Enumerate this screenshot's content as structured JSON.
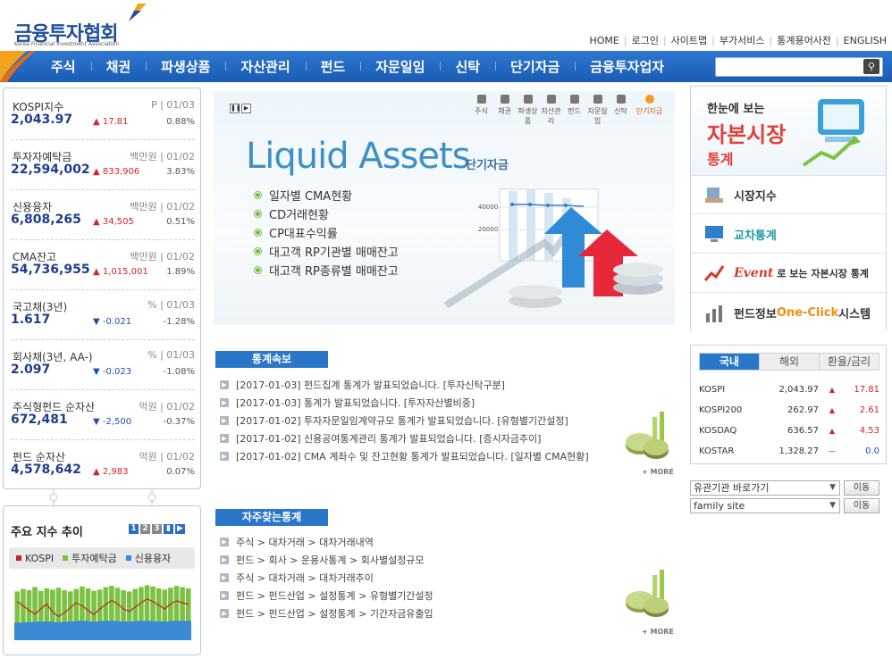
{
  "header": {
    "logo_title": "금융투자협회",
    "logo_subtitle": "Korea Financial Investment Association",
    "top_links": [
      "HOME",
      "로그인",
      "사이트맵",
      "부가서비스",
      "통계용어사전",
      "ENGLISH"
    ],
    "main_nav": [
      "주식",
      "채권",
      "파생상품",
      "자산관리",
      "펀드",
      "자문일임",
      "신탁",
      "단기자금",
      "금융투자업자"
    ],
    "search_placeholder": ""
  },
  "indices": [
    {
      "name": "KOSPI지수",
      "meta": "P | 01/03",
      "value": "2,043.97",
      "dir": "up",
      "change": "17.81",
      "pct": "0.88%"
    },
    {
      "name": "투자자예탁금",
      "meta": "백만원 | 01/02",
      "value": "22,594,002",
      "dir": "up",
      "change": "833,906",
      "pct": "3.83%"
    },
    {
      "name": "신용융자",
      "meta": "백만원 | 01/02",
      "value": "6,808,265",
      "dir": "up",
      "change": "34,505",
      "pct": "0.51%"
    },
    {
      "name": "CMA잔고",
      "meta": "백만원 | 01/02",
      "value": "54,736,955",
      "dir": "up",
      "change": "1,015,001",
      "pct": "1.89%"
    },
    {
      "name": "국고채(3년)",
      "meta": "% | 01/03",
      "value": "1.617",
      "dir": "dn",
      "change": "-0.021",
      "pct": "-1.28%"
    },
    {
      "name": "회사채(3년, AA-)",
      "meta": "% | 01/03",
      "value": "2.097",
      "dir": "dn",
      "change": "-0.023",
      "pct": "-1.08%"
    },
    {
      "name": "주식형펀드 순자산",
      "meta": "억원 | 01/02",
      "value": "672,481",
      "dir": "dn",
      "change": "-2,500",
      "pct": "-0.37%"
    },
    {
      "name": "펀드 순자산",
      "meta": "억원 | 01/02",
      "value": "4,578,642",
      "dir": "up",
      "change": "2,983",
      "pct": "0.07%"
    }
  ],
  "trend": {
    "title": "주요 지수 추이",
    "pages": [
      "1",
      "2",
      "3"
    ],
    "legend": [
      {
        "label": "KOSPI",
        "color": "#c8202a"
      },
      {
        "label": "투자예탁금",
        "color": "#7cc242"
      },
      {
        "label": "신용융자",
        "color": "#3a8ad6"
      }
    ]
  },
  "chart_data": {
    "type": "area",
    "title": "",
    "xlabel": "",
    "ylabel": "",
    "series": [
      {
        "name": "KOSPI",
        "values": [
          0.62,
          0.55,
          0.48,
          0.42,
          0.5,
          0.58,
          0.45,
          0.38,
          0.44,
          0.52,
          0.6,
          0.55,
          0.48,
          0.41,
          0.5,
          0.57,
          0.64,
          0.58,
          0.5,
          0.46,
          0.53,
          0.6,
          0.66,
          0.62,
          0.56,
          0.5,
          0.58,
          0.63,
          0.6,
          0.57
        ]
      },
      {
        "name": "투자예탁금",
        "values": [
          0.78,
          0.82,
          0.8,
          0.85,
          0.79,
          0.83,
          0.81,
          0.84,
          0.8,
          0.78,
          0.82,
          0.86,
          0.83,
          0.79,
          0.81,
          0.85,
          0.87,
          0.84,
          0.8,
          0.78,
          0.82,
          0.85,
          0.88,
          0.86,
          0.83,
          0.81,
          0.84,
          0.87,
          0.85,
          0.83
        ]
      },
      {
        "name": "신용융자",
        "values": [
          0.28,
          0.28,
          0.29,
          0.29,
          0.3,
          0.3,
          0.3,
          0.29,
          0.29,
          0.3,
          0.3,
          0.31,
          0.31,
          0.3,
          0.3,
          0.31,
          0.31,
          0.31,
          0.3,
          0.3,
          0.3,
          0.31,
          0.31,
          0.31,
          0.3,
          0.3,
          0.3,
          0.31,
          0.31,
          0.31
        ]
      }
    ]
  },
  "banner": {
    "tabs": [
      "주식",
      "채권",
      "파생상품",
      "자산관리",
      "펀드",
      "자문일임",
      "신탁",
      "단기자금"
    ],
    "active_tab": 7,
    "title": "Liquid Assets",
    "subtitle": "단기자금",
    "items": [
      "일자별 CMA현황",
      "CD거래현황",
      "CP대표수익률",
      "대고객 RP기관별 매매잔고",
      "대고객 RP종류별 매매잔고"
    ],
    "axis_labels": [
      "40000",
      "20000"
    ]
  },
  "news": {
    "header": "통계속보",
    "items": [
      "[2017-01-03] 펀드집계 통계가 발표되었습니다. [투자신탁구분]",
      "[2017-01-03] 통계가 발표되었습니다. [투자자산별비중]",
      "[2017-01-02] 투자자문일임계약규모 통계가 발표되었습니다. [유형별기간설정]",
      "[2017-01-02] 신용공여통계관리 통계가 발표되었습니다. [증시자금추이]",
      "[2017-01-02] CMA 계좌수 및 잔고현황 통계가 발표되었습니다. [일자별 CMA현황]"
    ],
    "more": "+ MORE"
  },
  "faq": {
    "header": "자주찾는통계",
    "items": [
      "주식 > 대차거래 > 대차거래내역",
      "펀드 > 회사 > 운용사통계 > 회사별설정규모",
      "주식 > 대차거래 > 대차거래추이",
      "펀드 > 펀드산업 > 설정통계 > 유형별기간설정",
      "펀드 > 펀드산업 > 설정통계 > 기간자금유출입"
    ],
    "more": "+ MORE"
  },
  "capital": {
    "line1": "한눈에 보는",
    "line2": "자본시장",
    "line3": "통계",
    "links": [
      {
        "label": "시장지수"
      },
      {
        "label": "교차통계"
      },
      {
        "event": "Event",
        "label": "로 보는 자본시장 통계"
      },
      {
        "label": "펀드정보",
        "accent": "One-Click",
        "tail": "시스템"
      }
    ]
  },
  "market": {
    "tabs": [
      "국내",
      "해외",
      "환율/금리"
    ],
    "rows": [
      {
        "name": "KOSPI",
        "value": "2,043.97",
        "dir": "▲",
        "change": "17.81"
      },
      {
        "name": "KOSPI200",
        "value": "262.97",
        "dir": "▲",
        "change": "2.61"
      },
      {
        "name": "KOSDAQ",
        "value": "636.57",
        "dir": "▲",
        "change": "4.53"
      },
      {
        "name": "KOSTAR",
        "value": "1,328.27",
        "dir": "—",
        "change": "0.0"
      }
    ]
  },
  "selects": {
    "related": "유관기관 바로가기",
    "family": "family site",
    "go": "이동"
  }
}
